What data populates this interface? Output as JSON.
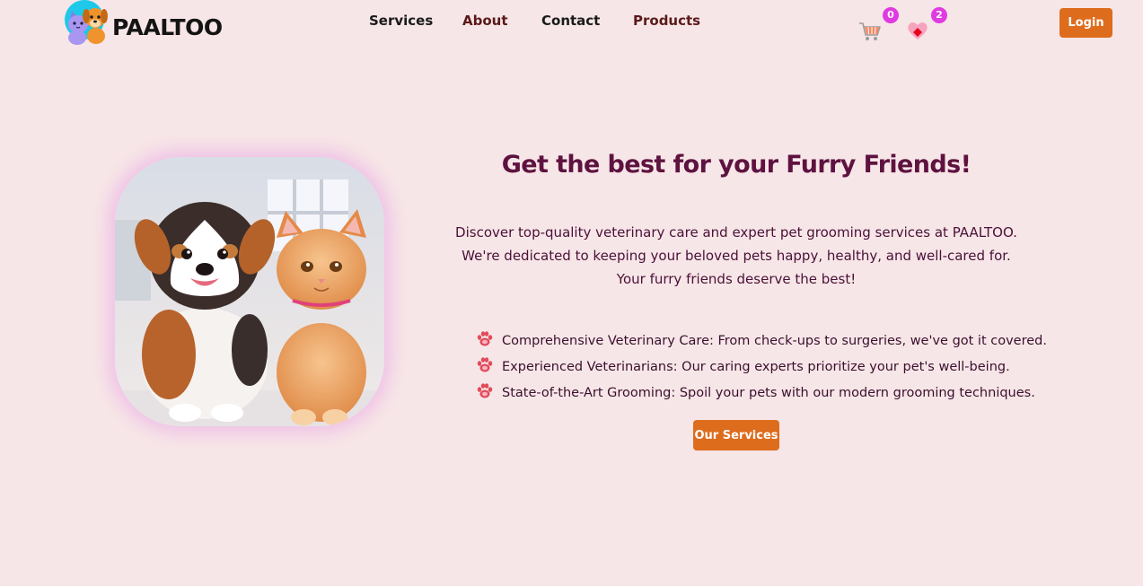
{
  "brand": {
    "name": "PAALTOO",
    "logo_icon": "dog-and-cat-logo-icon"
  },
  "nav": {
    "items": [
      {
        "label": "Services"
      },
      {
        "label": "About"
      },
      {
        "label": "Contact"
      },
      {
        "label": "Products"
      }
    ]
  },
  "header_actions": {
    "cart_icon": "shopping-cart-icon",
    "cart_count": "0",
    "wishlist_icon": "heart-icon",
    "wishlist_count": "2",
    "login_label": "Login"
  },
  "hero": {
    "image_icon": "puppy-and-kitten-photo",
    "title": "Get the best for your Furry Friends!",
    "description": "Discover top-quality veterinary care and expert pet grooming services at PAALTOO. We're dedicated to keeping your beloved pets happy, healthy, and well-cared for. Your furry friends deserve the best!",
    "features": [
      {
        "icon": "paw-icon",
        "text": "Comprehensive Veterinary Care: From check-ups to surgeries, we've got it covered."
      },
      {
        "icon": "paw-icon",
        "text": "Experienced Veterinarians: Our caring experts prioritize your pet's well-being."
      },
      {
        "icon": "paw-icon",
        "text": "State-of-the-Art Grooming: Spoil your pets with our modern grooming techniques."
      }
    ],
    "cta_label": "Our Services"
  },
  "colors": {
    "background": "#f7e6e7",
    "accent": "#de6c1d",
    "title": "#5e1240",
    "badge": "#e03be0"
  }
}
